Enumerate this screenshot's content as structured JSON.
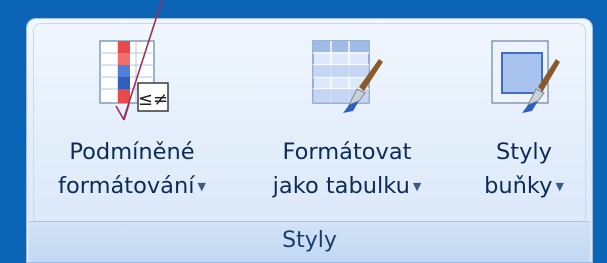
{
  "ribbon": {
    "group_label": "Styly",
    "buttons": [
      {
        "line1": "Podmíněné",
        "line2": "formátování",
        "icon": "conditional-formatting-icon"
      },
      {
        "line1": "Formátovat",
        "line2": "jako tabulku",
        "icon": "format-as-table-icon"
      },
      {
        "line1": "Styly",
        "line2": "buňky",
        "icon": "cell-styles-icon"
      }
    ]
  },
  "colors": {
    "window_background": "#0b64b6",
    "ribbon_background": "#e4eefb",
    "annotation_arrow": "#9b2f5a"
  }
}
